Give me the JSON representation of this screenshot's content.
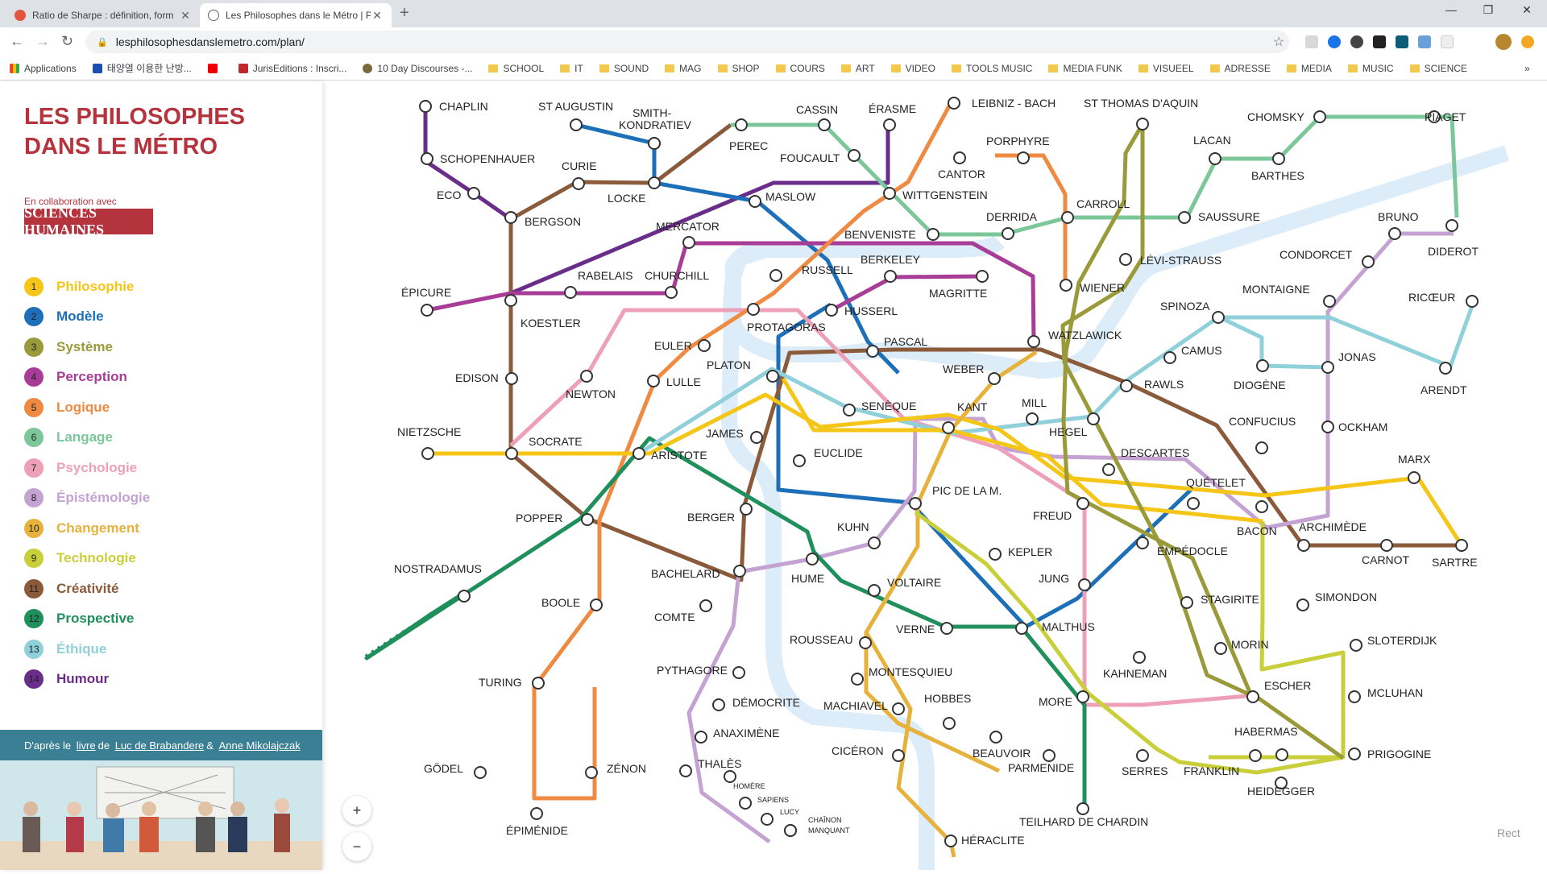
{
  "browser": {
    "tabs": [
      {
        "title": "Ratio de Sharpe : définition, form",
        "active": false
      },
      {
        "title": "Les Philosophes dans le Métro | P",
        "active": true
      }
    ],
    "url": "lesphilosophesdanslemetro.com/plan/",
    "bookmarks": [
      "Applications",
      "태양열 이용한 난방...",
      "",
      "JurisEditions : Inscri...",
      "10 Day Discourses -...",
      "SCHOOL",
      "IT",
      "SOUND",
      "MAG",
      "SHOP",
      "COURS",
      "ART",
      "VIDEO",
      "TOOLS MUSIC",
      "MEDIA FUNK",
      "VISUEEL",
      "ADRESSE",
      "MEDIA",
      "MUSIC",
      "SCIENCE"
    ],
    "more_bookmarks": "»"
  },
  "sidebar": {
    "title_line1": "LES PHILOSOPHES",
    "title_line2": "DANS LE MÉTRO",
    "collab": "En collaboration avec",
    "logo": "SCIENCES HUMAINES",
    "legend": [
      {
        "num": "1",
        "label": "Philosophie",
        "color": "#f5c518"
      },
      {
        "num": "2",
        "label": "Modèle",
        "color": "#1d6fb8"
      },
      {
        "num": "3",
        "label": "Système",
        "color": "#9a9a3a"
      },
      {
        "num": "4",
        "label": "Perception",
        "color": "#a83d97"
      },
      {
        "num": "5",
        "label": "Logique",
        "color": "#ef8a42"
      },
      {
        "num": "6",
        "label": "Langage",
        "color": "#7cc79a"
      },
      {
        "num": "7",
        "label": "Psychologie",
        "color": "#eea0b8"
      },
      {
        "num": "8",
        "label": "Épistémologie",
        "color": "#c4a3d3"
      },
      {
        "num": "10",
        "label": "Changement",
        "color": "#e6b23c"
      },
      {
        "num": "9",
        "label": "Technologie",
        "color": "#c9cf3a"
      },
      {
        "num": "11",
        "label": "Créativité",
        "color": "#8a5a3a"
      },
      {
        "num": "12",
        "label": "Prospective",
        "color": "#1f8f5c"
      },
      {
        "num": "13",
        "label": "Éthique",
        "color": "#8fd0db"
      },
      {
        "num": "14",
        "label": "Humour",
        "color": "#6b2d8a"
      }
    ],
    "credit_prefix": "D'après le",
    "credit_livre": "livre",
    "credit_de": "de",
    "credit_author1": "Luc de Brabandere",
    "credit_amp": "&",
    "credit_author2": "Anne Mikolajczak"
  },
  "map": {
    "zoom_in": "+",
    "zoom_out": "−",
    "corner_label": "Rect",
    "stations": [
      {
        "id": "chaplin",
        "label": "CHAPLIN"
      },
      {
        "id": "staugustin",
        "label": "ST AUGUSTIN"
      },
      {
        "id": "smith",
        "label": "SMITH-"
      },
      {
        "id": "kondratiev",
        "label": "KONDRATIEV"
      },
      {
        "id": "perec",
        "label": "PEREC"
      },
      {
        "id": "cassin",
        "label": "CASSIN"
      },
      {
        "id": "erasme",
        "label": "ÉRASME"
      },
      {
        "id": "leibniz",
        "label": "LEIBNIZ - BACH"
      },
      {
        "id": "stthomas",
        "label": "ST THOMAS D'AQUIN"
      },
      {
        "id": "chomsky",
        "label": "CHOMSKY"
      },
      {
        "id": "piaget",
        "label": "PIAGET"
      },
      {
        "id": "schopenhauer",
        "label": "SCHOPENHAUER"
      },
      {
        "id": "curie",
        "label": "CURIE"
      },
      {
        "id": "eco",
        "label": "ECO"
      },
      {
        "id": "locke",
        "label": "LOCKE"
      },
      {
        "id": "foucault",
        "label": "FOUCAULT"
      },
      {
        "id": "porphyre",
        "label": "PORPHYRE"
      },
      {
        "id": "cantor",
        "label": "CANTOR"
      },
      {
        "id": "lacan",
        "label": "LACAN"
      },
      {
        "id": "barthes",
        "label": "BARTHES"
      },
      {
        "id": "bergson",
        "label": "BERGSON"
      },
      {
        "id": "maslow",
        "label": "MASLOW"
      },
      {
        "id": "wittgenstein",
        "label": "WITTGENSTEIN"
      },
      {
        "id": "carroll",
        "label": "CARROLL"
      },
      {
        "id": "saussure",
        "label": "SAUSSURE"
      },
      {
        "id": "bruno",
        "label": "BRUNO"
      },
      {
        "id": "mercator",
        "label": "MERCATOR"
      },
      {
        "id": "derrida",
        "label": "DERRIDA"
      },
      {
        "id": "benveniste",
        "label": "BENVENISTE"
      },
      {
        "id": "diderot",
        "label": "DIDEROT"
      },
      {
        "id": "condorcet",
        "label": "CONDORCET"
      },
      {
        "id": "levistrauss",
        "label": "LÉVI-STRAUSS"
      },
      {
        "id": "berkeley",
        "label": "BERKELEY"
      },
      {
        "id": "russell",
        "label": "RUSSELL"
      },
      {
        "id": "rabelais",
        "label": "RABELAIS"
      },
      {
        "id": "churchill",
        "label": "CHURCHILL"
      },
      {
        "id": "epicure",
        "label": "ÉPICURE"
      },
      {
        "id": "wiener",
        "label": "WIENER"
      },
      {
        "id": "magritte",
        "label": "MAGRITTE"
      },
      {
        "id": "montaigne",
        "label": "MONTAIGNE"
      },
      {
        "id": "spinoza",
        "label": "SPINOZA"
      },
      {
        "id": "ricoeur",
        "label": "RICŒUR"
      },
      {
        "id": "koestler",
        "label": "KOESTLER"
      },
      {
        "id": "husserl",
        "label": "HUSSERL"
      },
      {
        "id": "protagoras",
        "label": "PROTAGORAS"
      },
      {
        "id": "watzlawick",
        "label": "WATZLAWICK"
      },
      {
        "id": "euler",
        "label": "EULER"
      },
      {
        "id": "pascal",
        "label": "PASCAL"
      },
      {
        "id": "camus",
        "label": "CAMUS"
      },
      {
        "id": "jonas",
        "label": "JONAS"
      },
      {
        "id": "platon",
        "label": "PLATON"
      },
      {
        "id": "edison",
        "label": "EDISON"
      },
      {
        "id": "lulle",
        "label": "LULLE"
      },
      {
        "id": "weber",
        "label": "WEBER"
      },
      {
        "id": "rawls",
        "label": "RAWLS"
      },
      {
        "id": "diogene",
        "label": "DIOGÈNE"
      },
      {
        "id": "arendt",
        "label": "ARENDT"
      },
      {
        "id": "newton",
        "label": "NEWTON"
      },
      {
        "id": "seneque",
        "label": "SENÈQUE"
      },
      {
        "id": "kant",
        "label": "KANT"
      },
      {
        "id": "mill",
        "label": "MILL"
      },
      {
        "id": "nietzsche",
        "label": "NIETZSCHE"
      },
      {
        "id": "hegel",
        "label": "HEGEL"
      },
      {
        "id": "confucius",
        "label": "CONFUCIUS"
      },
      {
        "id": "ockham",
        "label": "OCKHAM"
      },
      {
        "id": "socrate",
        "label": "SOCRATE"
      },
      {
        "id": "james",
        "label": "JAMES"
      },
      {
        "id": "aristote",
        "label": "ARISTOTE"
      },
      {
        "id": "euclide",
        "label": "EUCLIDE"
      },
      {
        "id": "descartes",
        "label": "DESCARTES"
      },
      {
        "id": "marx",
        "label": "MARX"
      },
      {
        "id": "queletet",
        "label": "QUÉTELET"
      },
      {
        "id": "picdelam",
        "label": "PIC DE LA M."
      },
      {
        "id": "freud",
        "label": "FREUD"
      },
      {
        "id": "bacon",
        "label": "BACON"
      },
      {
        "id": "archimede",
        "label": "ARCHIMÈDE"
      },
      {
        "id": "popper",
        "label": "POPPER"
      },
      {
        "id": "berger",
        "label": "BERGER"
      },
      {
        "id": "kuhn",
        "label": "KUHN"
      },
      {
        "id": "empedocle",
        "label": "EMPÉDOCLE"
      },
      {
        "id": "carnot",
        "label": "CARNOT"
      },
      {
        "id": "sartre",
        "label": "SARTRE"
      },
      {
        "id": "kepler",
        "label": "KEPLER"
      },
      {
        "id": "nostradamus",
        "label": "NOSTRADAMUS"
      },
      {
        "id": "bachelard",
        "label": "BACHELARD"
      },
      {
        "id": "hume",
        "label": "HUME"
      },
      {
        "id": "voltaire",
        "label": "VOLTAIRE"
      },
      {
        "id": "jung",
        "label": "JUNG"
      },
      {
        "id": "stagirite",
        "label": "STAGIRITE"
      },
      {
        "id": "simondon",
        "label": "SIMONDON"
      },
      {
        "id": "boole",
        "label": "BOOLE"
      },
      {
        "id": "comte",
        "label": "COMTE"
      },
      {
        "id": "verne",
        "label": "VERNE"
      },
      {
        "id": "malthus",
        "label": "MALTHUS"
      },
      {
        "id": "sloterdijk",
        "label": "SLOTERDIJK"
      },
      {
        "id": "rousseau",
        "label": "ROUSSEAU"
      },
      {
        "id": "morin",
        "label": "MORIN"
      },
      {
        "id": "turing",
        "label": "TURING"
      },
      {
        "id": "pythagore",
        "label": "PYTHAGORE"
      },
      {
        "id": "montesquieu",
        "label": "MONTESQUIEU"
      },
      {
        "id": "kahneman",
        "label": "KAHNEMAN"
      },
      {
        "id": "escher",
        "label": "ESCHER"
      },
      {
        "id": "mcluhan",
        "label": "MCLUHAN"
      },
      {
        "id": "democrite",
        "label": "DÉMOCRITE"
      },
      {
        "id": "machiavel",
        "label": "MACHIAVEL"
      },
      {
        "id": "hobbes",
        "label": "HOBBES"
      },
      {
        "id": "more",
        "label": "MORE"
      },
      {
        "id": "anaximene",
        "label": "ANAXIMÈNE"
      },
      {
        "id": "habermas",
        "label": "HABERMAS"
      },
      {
        "id": "thales",
        "label": "THALÈS"
      },
      {
        "id": "ciceron",
        "label": "CICÉRON"
      },
      {
        "id": "beauvoir",
        "label": "BEAUVOIR"
      },
      {
        "id": "prigogine",
        "label": "PRIGOGINE"
      },
      {
        "id": "godel",
        "label": "GÖDEL"
      },
      {
        "id": "zenon",
        "label": "ZÉNON"
      },
      {
        "id": "parmenide",
        "label": "PARMENIDE"
      },
      {
        "id": "serres",
        "label": "SERRES"
      },
      {
        "id": "franklin",
        "label": "FRANKLIN"
      },
      {
        "id": "homere",
        "label": "HOMÈRE"
      },
      {
        "id": "sapiens",
        "label": "SAPIENS"
      },
      {
        "id": "heidegger",
        "label": "HEIDEGGER"
      },
      {
        "id": "lucy",
        "label": "LUCY"
      },
      {
        "id": "chainon1",
        "label": "CHAÎNON"
      },
      {
        "id": "chainon2",
        "label": "MANQUANT"
      },
      {
        "id": "teilhard",
        "label": "TEILHARD DE CHARDIN"
      },
      {
        "id": "epimenide",
        "label": "ÉPIMÉNIDE"
      },
      {
        "id": "heraclite",
        "label": "HÉRACLITE"
      }
    ]
  }
}
